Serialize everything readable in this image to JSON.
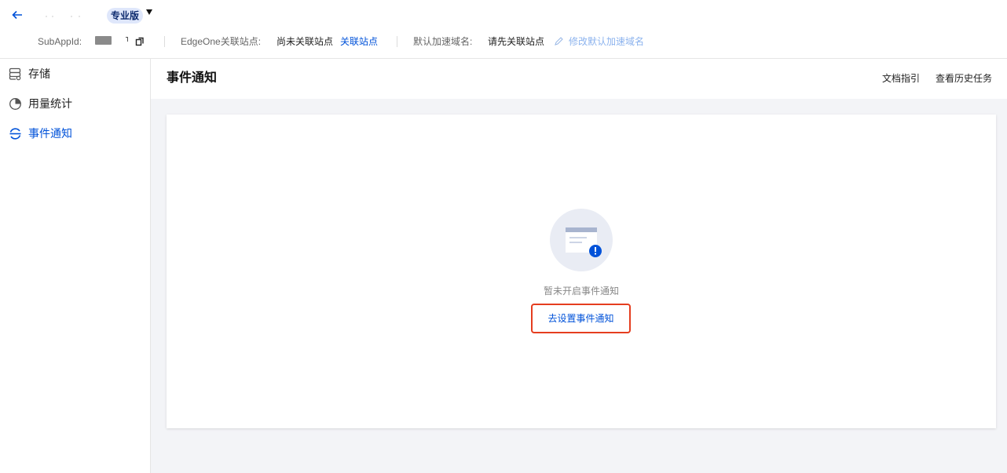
{
  "header": {
    "edition": "专业版",
    "subappid_label": "SubAppId:",
    "edgeone_label": "EdgeOne关联站点:",
    "edgeone_value": "尚未关联站点",
    "edgeone_link": "关联站点",
    "domain_label": "默认加速域名:",
    "domain_value": "请先关联站点",
    "domain_edit": "修改默认加速域名"
  },
  "sidebar": {
    "items": [
      {
        "label": "存储",
        "icon": "storage-icon",
        "active": false
      },
      {
        "label": "用量统计",
        "icon": "usage-stats-icon",
        "active": false
      },
      {
        "label": "事件通知",
        "icon": "event-notify-icon",
        "active": true
      }
    ]
  },
  "main": {
    "title": "事件通知",
    "links": {
      "docs": "文档指引",
      "history": "查看历史任务"
    },
    "empty_text": "暂未开启事件通知",
    "setup_button": "去设置事件通知"
  },
  "colors": {
    "accent": "#0052d9",
    "highlight": "#e53d1f",
    "badge_bg": "#dfe7fb"
  }
}
